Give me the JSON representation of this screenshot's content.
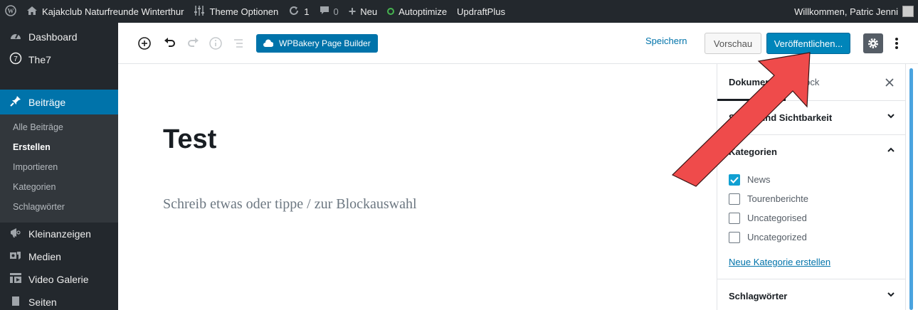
{
  "adminbar": {
    "site_name": "Kajakclub Naturfreunde Winterthur",
    "theme_options": "Theme Optionen",
    "updates_count": "1",
    "comments_count": "0",
    "new_label": "Neu",
    "autoptimize_label": "Autoptimize",
    "updraft_label": "UpdraftPlus",
    "greeting": "Willkommen, Patric Jenni"
  },
  "sidebar": {
    "dashboard": "Dashboard",
    "the7": "The7",
    "posts": "Beiträge",
    "submenu": [
      "Alle Beiträge",
      "Erstellen",
      "Importieren",
      "Kategorien",
      "Schlagwörter"
    ],
    "classifieds": "Kleinanzeigen",
    "media": "Medien",
    "video_gallery": "Video Galerie",
    "pages": "Seiten"
  },
  "toolbar": {
    "wpbakery_label": "WPBakery Page Builder",
    "save_label": "Speichern",
    "preview_label": "Vorschau",
    "publish_label": "Veröffentlichen..."
  },
  "editor": {
    "title": "Test",
    "placeholder": "Schreib etwas oder tippe / zur Blockauswahl"
  },
  "panel": {
    "tab_document": "Dokument",
    "tab_block": "Block",
    "section_status": "Status und Sichtbarkeit",
    "section_categories": "Kategorien",
    "categories": [
      {
        "label": "News",
        "checked": true
      },
      {
        "label": "Tourenberichte",
        "checked": false
      },
      {
        "label": "Uncategorised",
        "checked": false
      },
      {
        "label": "Uncategorized",
        "checked": false
      }
    ],
    "new_category_link": "Neue Kategorie erstellen",
    "section_tags": "Schlagwörter"
  },
  "colors": {
    "admin_dark": "#23282d",
    "wp_blue": "#0073aa",
    "checkbox_blue": "#11a0d2",
    "annotation_red": "#ef4b4b"
  }
}
